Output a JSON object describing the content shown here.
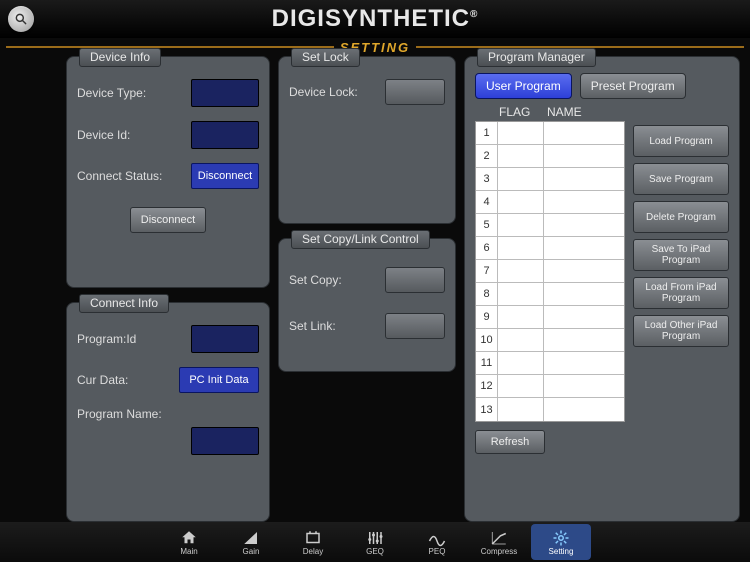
{
  "brand": "DIGISYNTHETIC",
  "tab_title": "SETTING",
  "device_info": {
    "title": "Device Info",
    "type_label": "Device Type:",
    "id_label": "Device Id:",
    "status_label": "Connect Status:",
    "status_value": "Disconnect",
    "disconnect_btn": "Disconnect"
  },
  "connect_info": {
    "title": "Connect Info",
    "program_id_label": "Program:Id",
    "cur_data_label": "Cur Data:",
    "cur_data_value": "PC Init Data",
    "program_name_label": "Program Name:"
  },
  "set_lock": {
    "title": "Set Lock",
    "device_lock_label": "Device Lock:"
  },
  "set_copy": {
    "title": "Set Copy/Link Control",
    "copy_label": "Set Copy:",
    "link_label": "Set Link:"
  },
  "program_manager": {
    "title": "Program Manager",
    "user_tab": "User Program",
    "preset_tab": "Preset Program",
    "col_flag": "FLAG",
    "col_name": "NAME",
    "rows": [
      1,
      2,
      3,
      4,
      5,
      6,
      7,
      8,
      9,
      10,
      11,
      12,
      13
    ],
    "buttons": {
      "load": "Load Program",
      "save": "Save Program",
      "delete": "Delete Program",
      "save_ipad": "Save To iPad Program",
      "load_ipad": "Load From iPad Program",
      "load_other": "Load Other iPad Program"
    },
    "refresh": "Refresh"
  },
  "nav": {
    "main": "Main",
    "gain": "Gain",
    "delay": "Delay",
    "geq": "GEQ",
    "peq": "PEQ",
    "compress": "Compress",
    "setting": "Setting"
  }
}
